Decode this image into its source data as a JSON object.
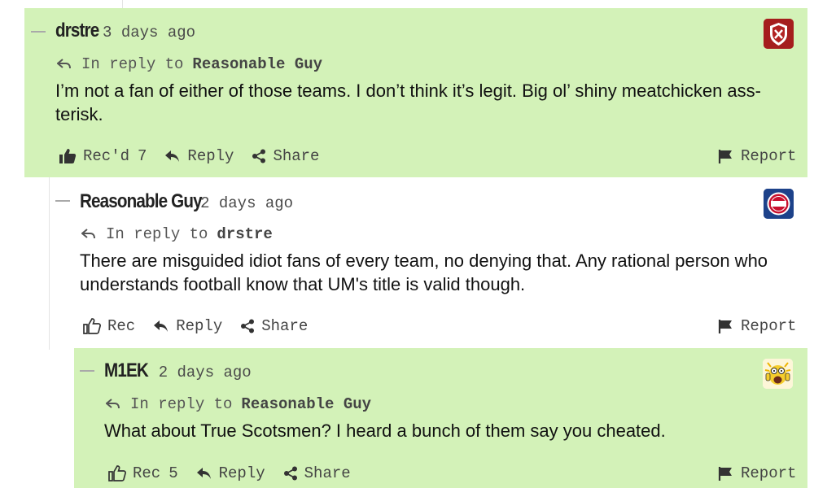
{
  "comments": [
    {
      "author": "drstre",
      "time": "3 days ago",
      "reply_prefix": "In reply to",
      "reply_to": "Reasonable Guy",
      "body": "I’m not a fan of either of those teams. I don’t think it’s legit. Big ol’ shiny meatchicken ass-terisk.",
      "rec_label": "Rec'd",
      "rec_count": "7",
      "reply_label": "Reply",
      "share_label": "Share",
      "report_label": "Report",
      "avatar_icon": "red-shield-crest-icon",
      "highlighted": true
    },
    {
      "author": "Reasonable Guy",
      "time": "2 days ago",
      "reply_prefix": "In reply to",
      "reply_to": "drstre",
      "body": "There are misguided idiot fans of every team, no denying that. Any rational person who understands football know that UM's title is valid though.",
      "rec_label": "Rec",
      "rec_count": "",
      "reply_label": "Reply",
      "share_label": "Share",
      "report_label": "Report",
      "avatar_icon": "detroit-pistons-logo-icon",
      "highlighted": false
    },
    {
      "author": "M1EK",
      "time": "2 days ago",
      "reply_prefix": "In reply to",
      "reply_to": "Reasonable Guy",
      "body": "What about True Scotsmen? I heard a bunch of them say you cheated.",
      "rec_label": "Rec",
      "rec_count": "5",
      "reply_label": "Reply",
      "share_label": "Share",
      "report_label": "Report",
      "avatar_icon": "screaming-cartoon-face-icon",
      "highlighted": true
    }
  ],
  "colors": {
    "highlight_bg": "#d3f2b8",
    "text": "#111111",
    "muted": "#4a4a4a"
  }
}
